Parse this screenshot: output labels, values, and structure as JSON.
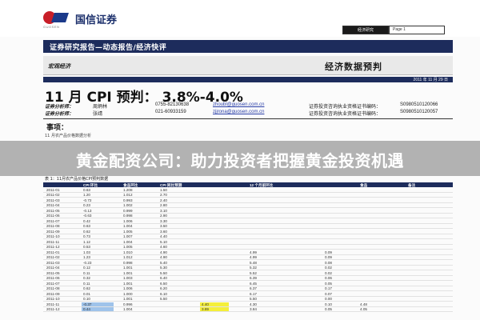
{
  "header": {
    "logo_name": "国信证券",
    "logo_sub": "GUOSEN",
    "box_dark": "经济研究",
    "box_light": "Page 1"
  },
  "navy_bar": "证券研究报告—动态报告/经济快评",
  "macro": {
    "left": "宏观经济",
    "right": "经济数据预判"
  },
  "date": "2011 年 11 月 29 日",
  "title": "11 月 CPI 预判：  3.8%-4.0%",
  "analysts": [
    {
      "role": "证券分析师：",
      "name": "周炳林",
      "phone": "0755-82130638",
      "email": "zhoubl@guosen.com.cn",
      "cert_label": "证券投资咨询执业资格证书编码：",
      "cert": "S0980510120066"
    },
    {
      "role": "证券分析师：",
      "name": "张靖",
      "phone": "021-60933159",
      "email": "zjjrona@guosen.com.cn",
      "cert_label": "证券投资咨询执业资格证书编码：",
      "cert": "S0980510120057"
    }
  ],
  "events_label": "事项：",
  "section_line": "11 月农产品价格数据分析",
  "overlay_text": "黄金配资公司：助力投资者把握黄金投资机遇",
  "table": {
    "caption": "表 1：11月农产品价格CPI预判数据",
    "headers": [
      "",
      "CPI 环比",
      "食品环比",
      "CPI 同比预测",
      "",
      "12 个月前环比",
      "",
      "",
      "食品",
      "备注"
    ],
    "rows": [
      [
        "2011-01",
        "0.63",
        "1.208",
        "1.50",
        "",
        "",
        "",
        "",
        "",
        ""
      ],
      [
        "2011-02",
        "1.20",
        "1.012",
        "2.70",
        "",
        "",
        "",
        "",
        "",
        ""
      ],
      [
        "2011-03",
        "-0.72",
        "0.993",
        "2.40",
        "",
        "",
        "",
        "",
        "",
        ""
      ],
      [
        "2011-04",
        "0.23",
        "1.002",
        "2.80",
        "",
        "",
        "",
        "",
        "",
        ""
      ],
      [
        "2011-05",
        "-0.13",
        "0.999",
        "3.10",
        "",
        "",
        "",
        "",
        "",
        ""
      ],
      [
        "2011-06",
        "-0.63",
        "0.998",
        "2.90",
        "",
        "",
        "",
        "",
        "",
        ""
      ],
      [
        "2011-07",
        "0.42",
        "1.006",
        "3.30",
        "",
        "",
        "",
        "",
        "",
        ""
      ],
      [
        "2011-08",
        "0.63",
        "1.004",
        "3.50",
        "",
        "",
        "",
        "",
        "",
        ""
      ],
      [
        "2011-09",
        "0.62",
        "1.005",
        "3.60",
        "",
        "",
        "",
        "",
        "",
        ""
      ],
      [
        "2011-10",
        "0.73",
        "1.007",
        "4.40",
        "",
        "",
        "",
        "",
        "",
        ""
      ],
      [
        "2011-11",
        "1.12",
        "1.004",
        "5.10",
        "",
        "",
        "",
        "",
        "",
        ""
      ],
      [
        "2011-12",
        "0.53",
        "1.005",
        "4.60",
        "",
        "",
        "",
        "",
        "",
        ""
      ],
      [
        "2011-01",
        "1.03",
        "1.010",
        "4.90",
        "",
        "4.99",
        "",
        "0.09",
        "",
        ""
      ],
      [
        "2011-02",
        "1.23",
        "1.012",
        "4.90",
        "",
        "4.99",
        "",
        "0.09",
        "",
        ""
      ],
      [
        "2011-03",
        "-0.23",
        "0.998",
        "5.40",
        "",
        "5.48",
        "",
        "0.08",
        "",
        ""
      ],
      [
        "2011-04",
        "0.12",
        "1.001",
        "5.30",
        "",
        "5.32",
        "",
        "0.02",
        "",
        ""
      ],
      [
        "2011-05",
        "0.11",
        "1.001",
        "5.50",
        "",
        "5.52",
        "",
        "0.02",
        "",
        ""
      ],
      [
        "2011-06",
        "0.32",
        "1.003",
        "6.40",
        "",
        "6.39",
        "",
        "0.06",
        "",
        ""
      ],
      [
        "2011-07",
        "0.11",
        "1.001",
        "6.50",
        "",
        "6.45",
        "",
        "0.05",
        "",
        ""
      ],
      [
        "2011-08",
        "0.62",
        "1.006",
        "6.20",
        "",
        "6.37",
        "",
        "0.17",
        "",
        ""
      ],
      [
        "2011-09",
        "0.01",
        "1.000",
        "6.10",
        "",
        "6.17",
        "",
        "0.07",
        "",
        ""
      ],
      [
        "2011-10",
        "0.10",
        "1.001",
        "5.50",
        "",
        "5.50",
        "",
        "0.00",
        "",
        ""
      ],
      [
        "2011-11",
        "-0.37",
        "0.996",
        "4.40",
        "",
        "4.30",
        "",
        "0.10",
        "4.48",
        "",
        "hl"
      ],
      [
        "2011-12",
        "0.44",
        "1.004",
        "3.89",
        "",
        "3.84",
        "",
        "0.05",
        "4.05",
        "",
        "hl"
      ]
    ]
  }
}
